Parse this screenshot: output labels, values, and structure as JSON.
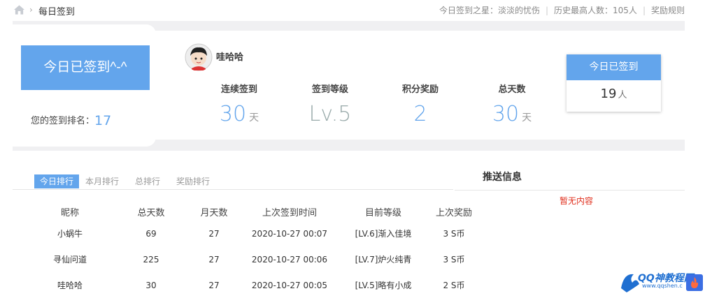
{
  "breadcrumb": {
    "home_icon": "home-icon",
    "title": "每日签到"
  },
  "top_right": {
    "star_label": "今日签到之星：淡淡的忧伤",
    "record_label": "历史最高人数：105人",
    "rules_label": "奖励规则"
  },
  "sign_panel": {
    "button_label": "今日已签到^-^",
    "rank_label": "您的签到排名：",
    "rank_value": "17"
  },
  "user": {
    "name": "哇哈哈",
    "avatar_icon": "user-avatar-icon"
  },
  "stats": [
    {
      "label": "连续签到",
      "value": "30",
      "unit": "天"
    },
    {
      "label": "签到等级",
      "value": "Lv.5",
      "unit": ""
    },
    {
      "label": "积分奖励",
      "value": "2",
      "unit": ""
    },
    {
      "label": "总天数",
      "value": "30",
      "unit": "天"
    }
  ],
  "today_box": {
    "title": "今日已签到",
    "count": "19",
    "unit": "人"
  },
  "tabs": [
    {
      "label": "今日排行",
      "active": true
    },
    {
      "label": "本月排行",
      "active": false
    },
    {
      "label": "总排行",
      "active": false
    },
    {
      "label": "奖励排行",
      "active": false
    }
  ],
  "push": {
    "title": "推送信息",
    "empty": "暂无内容"
  },
  "table": {
    "headers": [
      "昵称",
      "总天数",
      "月天数",
      "上次签到时间",
      "目前等级",
      "上次奖励"
    ],
    "rows": [
      [
        "小蜗牛",
        "69",
        "27",
        "2020-10-27 00:07",
        "[LV.6]渐入佳境",
        "3 S币"
      ],
      [
        "寻仙问道",
        "225",
        "27",
        "2020-10-27 00:06",
        "[LV.7]炉火纯青",
        "3 S币"
      ],
      [
        "哇哈哈",
        "30",
        "27",
        "2020-10-27 00:05",
        "[LV.5]略有小成",
        "2 S币"
      ]
    ]
  },
  "watermark": {
    "text": "QQ神教程网",
    "url": "www.qqshen.c",
    "logo_icon": "dragon-logo-icon",
    "fire_icon": "fire-icon"
  },
  "colors": {
    "accent": "#63a5ec",
    "band": "#f0f0f2",
    "empty_red": "#e0301e"
  }
}
